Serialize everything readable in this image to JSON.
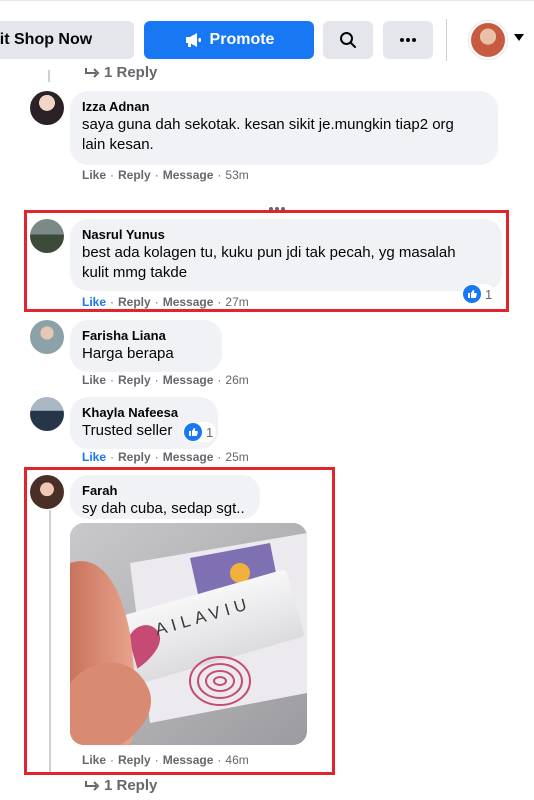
{
  "toolbar": {
    "edit_shop_label": "dit Shop Now",
    "promote_label": "Promote",
    "search_icon": "search-icon",
    "more_icon": "more-horizontal-icon"
  },
  "thread": {
    "top_reply_label": "1 Reply",
    "bottom_reply_label": "1 Reply",
    "more_comments_icon": "more-horizontal-icon"
  },
  "actions": {
    "like": "Like",
    "reply": "Reply",
    "message": "Message",
    "sep": "·"
  },
  "comments": [
    {
      "name": "Izza Adnan",
      "text_lines": [
        "saya guna dah sekotak. kesan sikit je.mungkin tiap2 org",
        "lain kesan."
      ],
      "time": "53m",
      "liked": false,
      "reactions": null
    },
    {
      "name": "Nasrul Yunus",
      "text_lines": [
        "best ada kolagen tu, kuku pun jdi tak pecah, yg masalah",
        "kulit mmg takde"
      ],
      "time": "27m",
      "liked": true,
      "reactions": "1",
      "highlighted": true
    },
    {
      "name": "Farisha Liana",
      "text_lines": [
        "Harga berapa"
      ],
      "time": "26m",
      "liked": false,
      "reactions": null
    },
    {
      "name": "Khayla Nafeesa",
      "text_lines": [
        "Trusted seller"
      ],
      "time": "25m",
      "liked": true,
      "reactions": "1"
    },
    {
      "name": "Farah",
      "text_lines": [
        "sy dah cuba, sedap sgt.."
      ],
      "time": "46m",
      "liked": false,
      "reactions": null,
      "highlighted": true,
      "has_photo": true
    }
  ],
  "photo": {
    "brand_text": "AILAVIU"
  },
  "colors": {
    "accent": "#1877f2",
    "highlight": "#e0252c",
    "bubble": "#f0f2f5",
    "muted": "#65676b"
  }
}
